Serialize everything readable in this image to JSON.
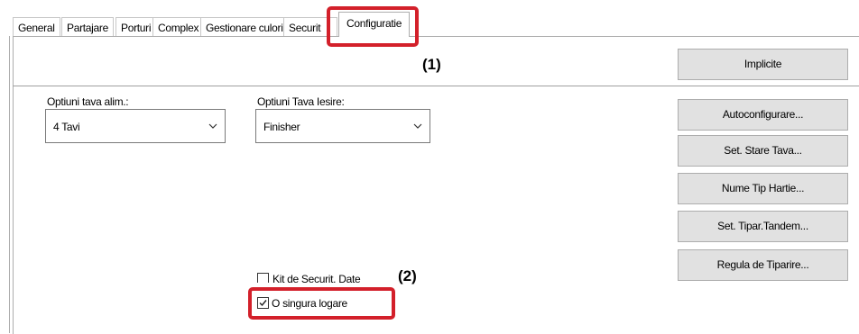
{
  "tabs": [
    {
      "label": "General"
    },
    {
      "label": "Partajare"
    },
    {
      "label": "Porturi"
    },
    {
      "label": "Complex"
    },
    {
      "label": "Gestionare culori"
    },
    {
      "label": "Securit"
    },
    {
      "label": "Configuratie",
      "active": true
    }
  ],
  "buttons": {
    "implicite": "Implicite",
    "autoconfig": "Autoconfigurare...",
    "set_stare_tava": "Set. Stare Tava...",
    "nume_tip_hartie": "Nume Tip Hartie...",
    "set_tipar_tandem": "Set. Tipar.Tandem...",
    "regula_tiparire": "Regula de Tiparire..."
  },
  "input_tray": {
    "label": "Optiuni tava alim.:",
    "value": "4 Tavi"
  },
  "output_tray": {
    "label": "Optiuni Tava Iesire:",
    "value": "Finisher"
  },
  "checkboxes": {
    "kit_securit": {
      "label": "Kit de Securit. Date",
      "checked": false
    },
    "o_singura_logare": {
      "label": "O singura logare",
      "checked": true
    }
  },
  "callouts": {
    "one": "(1)",
    "two": "(2)"
  },
  "colors": {
    "highlight": "#d3202a",
    "button_bg": "#e1e1e1"
  }
}
